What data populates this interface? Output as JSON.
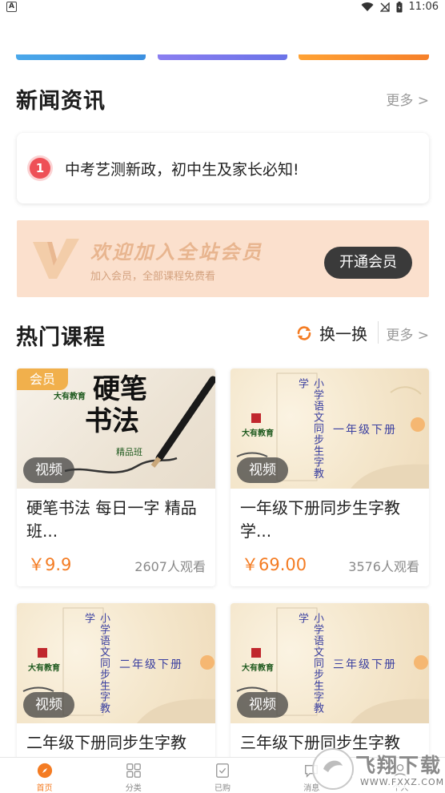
{
  "status_bar": {
    "notification_letter": "A",
    "time": "11:06"
  },
  "news": {
    "section_title": "新闻资讯",
    "more_label": "更多 >",
    "items": [
      {
        "index": "1",
        "text": "中考艺测新政，初中生及家长必知!"
      }
    ]
  },
  "member_banner": {
    "title": "欢迎加入全站会员",
    "subtitle": "加入会员，全部课程免费看",
    "button_label": "开通会员"
  },
  "hot_courses": {
    "section_title": "热门课程",
    "refresh_label": "换一换",
    "more_label": "更多 >",
    "video_label": "视频",
    "member_tag": "会员",
    "courses": [
      {
        "title": "硬笔书法 每日一字 精品班...",
        "price": "￥9.9",
        "views": "2607人观看",
        "thumb_text": [
          "硬笔",
          "书法",
          "精品班"
        ],
        "thumb_brand": "大有教育"
      },
      {
        "title": "一年级下册同步生字教学...",
        "price": "￥69.00",
        "views": "3576人观看",
        "thumb_vertical": "小学语文同步生字教学",
        "thumb_grade": "一年级下册",
        "thumb_brand": "大有教育"
      },
      {
        "title": "二年级下册同步生字教",
        "thumb_vertical": "小学语文同步生字教学",
        "thumb_grade": "二年级下册",
        "thumb_brand": "大有教育"
      },
      {
        "title": "三年级下册同步生字教",
        "thumb_vertical": "小学语文同步生字教学",
        "thumb_grade": "三年级下册",
        "thumb_brand": "大有教育"
      }
    ]
  },
  "tabbar": {
    "items": [
      {
        "label": "首页",
        "icon": "compass-icon",
        "active": true
      },
      {
        "label": "分类",
        "icon": "grid-icon"
      },
      {
        "label": "已购",
        "icon": "purchased-icon"
      },
      {
        "label": "消息",
        "icon": "message-icon"
      },
      {
        "label": "个人",
        "icon": "person-icon"
      }
    ]
  },
  "watermark": {
    "brand": "飞翔下载",
    "url": "WWW.FXXZ.COM"
  },
  "colors": {
    "accent": "#f47c23",
    "price": "#f47c23",
    "member_tag": "#f1b04c",
    "news_badge": "#ee5057",
    "member_banner_bg": "#fbe0cd"
  }
}
